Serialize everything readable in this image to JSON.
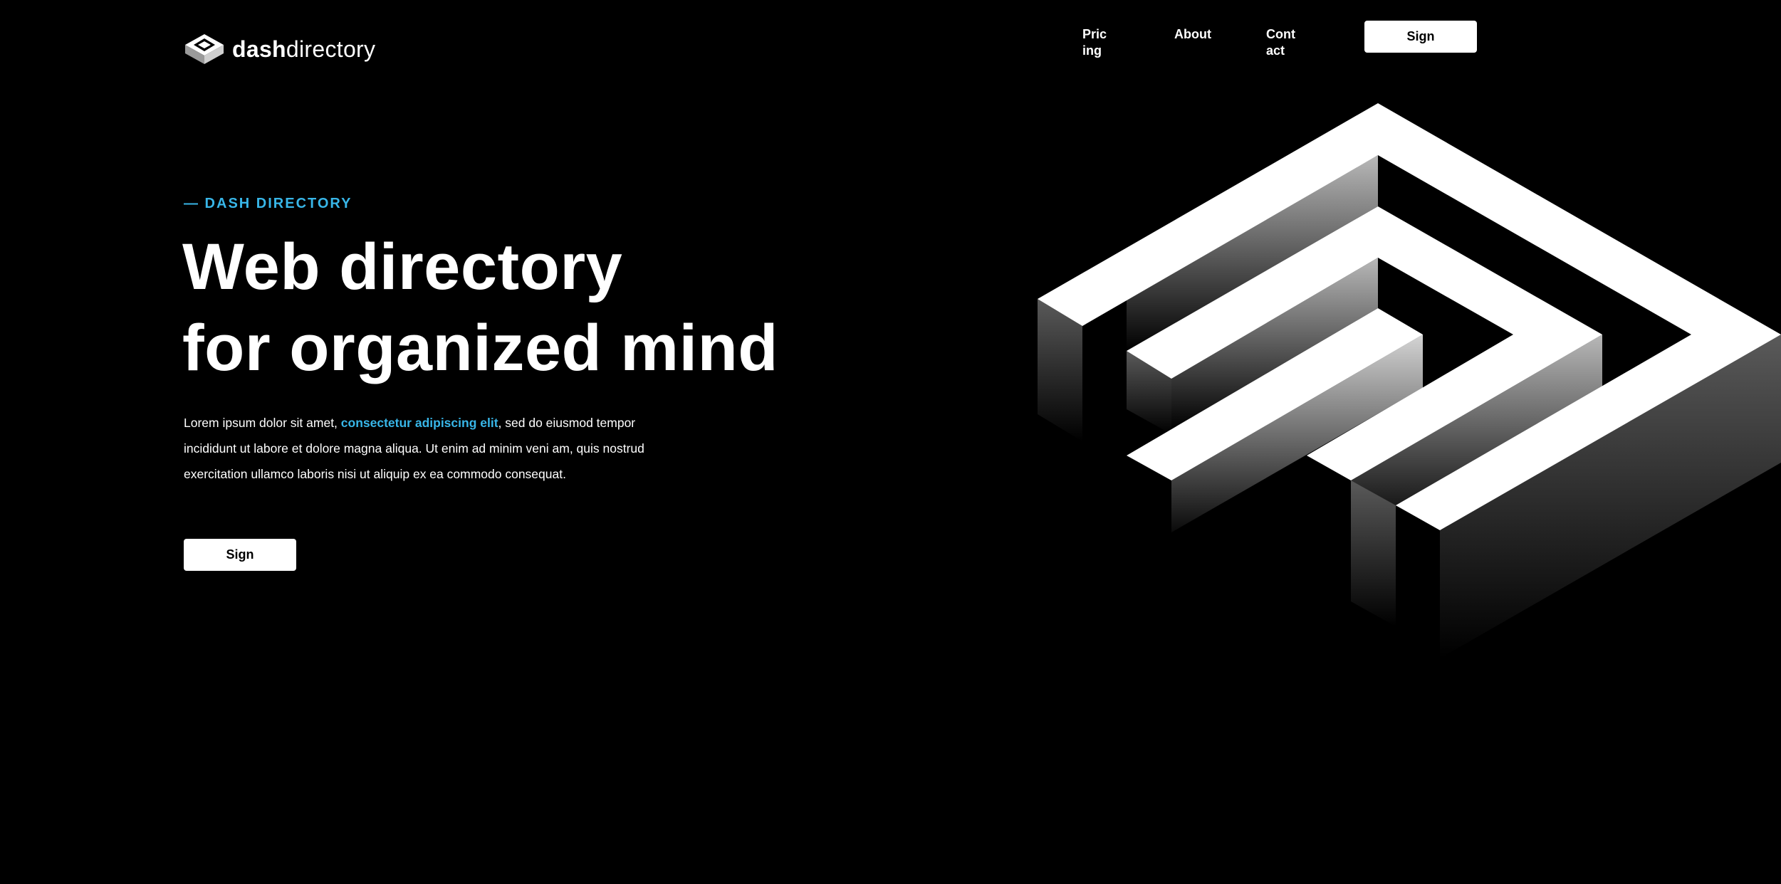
{
  "brand": {
    "name_bold": "dash",
    "name_regular": "directory",
    "logo_icon": "isometric-stack-logo"
  },
  "nav": {
    "items": [
      {
        "label": "Pric ing"
      },
      {
        "label": "About"
      },
      {
        "label": "Cont act"
      }
    ],
    "cta_label": "Sign"
  },
  "hero": {
    "eyebrow": "— DASH DIRECTORY",
    "headline_line1": "Web directory",
    "headline_line2": "for organized mind",
    "paragraph_pre": "Lorem ipsum dolor sit amet, ",
    "paragraph_link": "consectetur adipiscing elit",
    "paragraph_post": ", sed do eiusmod tempor incididunt ut labore et dolore magna aliqua. Ut enim ad minim veni am, quis nostrud exercitation ullamco laboris nisi ut aliquip ex ea commodo consequat.",
    "cta_label": "Sign"
  },
  "art": {
    "name": "isometric-maze-illustration"
  },
  "colors": {
    "background": "#000000",
    "accent": "#38b6e8",
    "text": "#ffffff",
    "button_bg": "#ffffff",
    "button_text": "#000000"
  }
}
